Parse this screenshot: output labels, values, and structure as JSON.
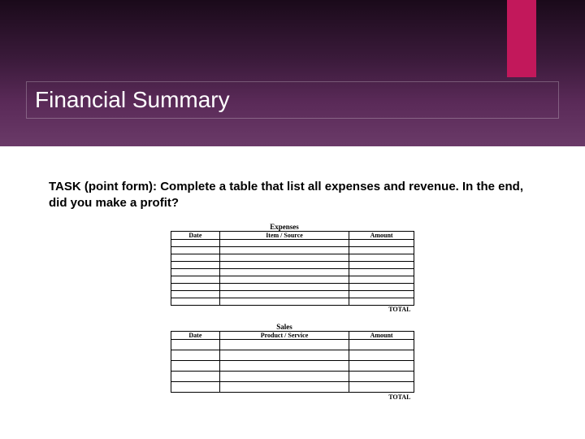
{
  "header": {
    "title": "Financial Summary"
  },
  "task": {
    "label": "TASK (point form):",
    "body_part1": "  Complete a table that list all expenses and revenue.  In the end, did you make a profit?"
  },
  "expenses_table": {
    "title": "Expenses",
    "col_date": "Date",
    "col_mid": "Item / Source",
    "col_amount": "Amount",
    "total_label": "TOTAL",
    "blank_rows": 9
  },
  "sales_table": {
    "title": "Sales",
    "col_date": "Date",
    "col_mid": "Product / Service",
    "col_amount": "Amount",
    "total_label": "TOTAL",
    "blank_rows": 5
  }
}
